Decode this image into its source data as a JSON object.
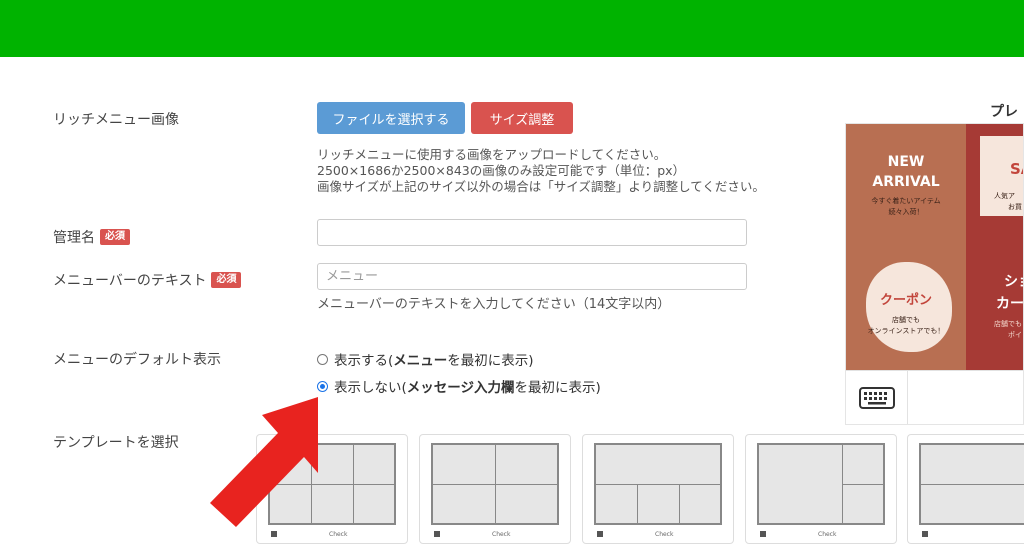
{
  "form": {
    "rich_menu_image_label": "リッチメニュー画像",
    "file_select_button": "ファイルを選択する",
    "resize_button": "サイズ調整",
    "help_lines": [
      "リッチメニューに使用する画像をアップロードしてください。",
      "2500×1686か2500×843の画像のみ設定可能です（単位：px）",
      "画像サイズが上記のサイズ以外の場合は「サイズ調整」より調整してください。"
    ],
    "admin_name_label": "管理名",
    "required_badge": "必須",
    "admin_name_value": "",
    "menu_bar_text_label": "メニューバーのテキスト",
    "menu_bar_placeholder": "メニュー",
    "menu_bar_help": "メニューバーのテキストを入力してください（14文字以内）",
    "default_display_label": "メニューのデフォルト表示",
    "radio_show": {
      "prefix": "表示する(",
      "bold": "メニュー",
      "suffix": "を最初に表示)"
    },
    "radio_hide": {
      "prefix": "表示しない(",
      "bold": "メッセージ入力欄",
      "suffix": "を最初に表示)"
    },
    "selected_option": "hide",
    "template_label": "テンプレートを選択"
  },
  "preview": {
    "title": "プレ",
    "cells": [
      {
        "lines": [
          "NEW",
          "ARRIVAL"
        ],
        "sub": [
          "今すぐ着たいアイテム",
          "続々入荷！"
        ]
      },
      {
        "lines": [
          "SA"
        ],
        "sub": [
          "人気ア",
          "お買"
        ]
      },
      {
        "lines": [
          "クーポン"
        ],
        "sub": [
          "店舗でも",
          "オンラインストアでも！"
        ]
      },
      {
        "lines": [
          "ショ",
          "カー"
        ],
        "sub": [
          "店舗でも",
          "ポイン"
        ]
      }
    ],
    "keyboard_icon": "keyboard-icon"
  },
  "templates": {
    "caption": "Check"
  },
  "colors": {
    "header_green": "#00b300",
    "primary": "#5b9bd5",
    "danger": "#d9534f",
    "arrow": "#e8231f",
    "preview_brown": "#b86f52",
    "preview_red": "#a63a35"
  }
}
